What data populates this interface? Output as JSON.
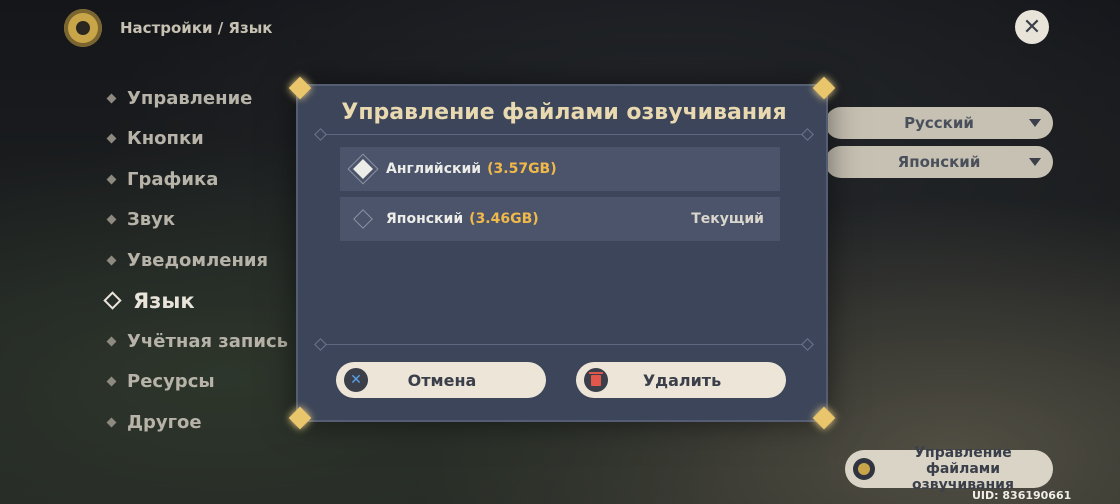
{
  "header": {
    "breadcrumb": "Настройки / Язык"
  },
  "nav": {
    "items": [
      {
        "label": "Управление"
      },
      {
        "label": "Кнопки"
      },
      {
        "label": "Графика"
      },
      {
        "label": "Звук"
      },
      {
        "label": "Уведомления"
      },
      {
        "label": "Язык",
        "active": true
      },
      {
        "label": "Учётная запись"
      },
      {
        "label": "Ресурсы"
      },
      {
        "label": "Другое"
      }
    ]
  },
  "settings": {
    "text_language": "Русский",
    "voice_language": "Японский"
  },
  "modal": {
    "title": "Управление файлами озвучивания",
    "options": [
      {
        "name": "Английский",
        "size": "(3.57GB)",
        "selected": true,
        "status": ""
      },
      {
        "name": "Японский",
        "size": "(3.46GB)",
        "selected": false,
        "status": "Текущий"
      }
    ],
    "cancel_label": "Отмена",
    "delete_label": "Удалить"
  },
  "footer": {
    "manage_voice_label": "Управление файлами озвучивания",
    "uid": "UID: 836190661"
  },
  "colors": {
    "accent_gold": "#f0b94a",
    "title": "#e9d9b0",
    "modal_bg": "#3c4559"
  },
  "icons": {
    "settings": "gear-icon",
    "close": "close-icon",
    "cancel": "x-icon",
    "delete": "trash-icon"
  }
}
